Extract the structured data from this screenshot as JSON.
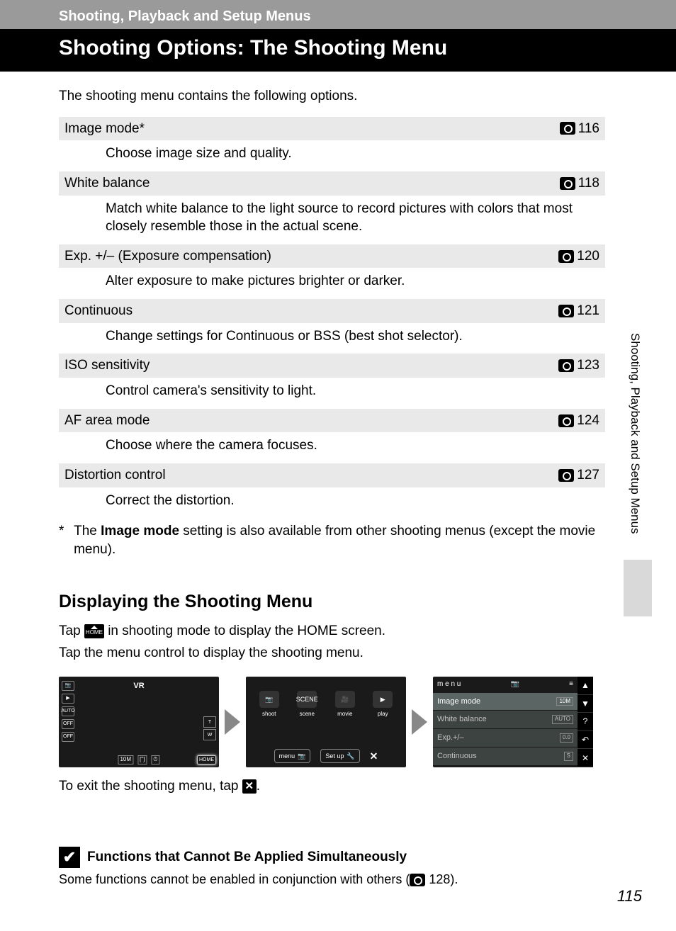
{
  "header": {
    "breadcrumb": "Shooting, Playback and Setup Menus",
    "title": "Shooting Options: The Shooting Menu"
  },
  "intro": "The shooting menu contains the following options.",
  "options": [
    {
      "title": "Image mode*",
      "page": "116",
      "desc": "Choose image size and quality."
    },
    {
      "title": "White balance",
      "page": "118",
      "desc": "Match white balance to the light source to record pictures with colors that most closely resemble those in the actual scene."
    },
    {
      "title": "Exp. +/– (Exposure compensation)",
      "page": "120",
      "desc": "Alter exposure to make pictures brighter or darker."
    },
    {
      "title": "Continuous",
      "page": "121",
      "desc": "Change settings for Continuous or BSS (best shot selector)."
    },
    {
      "title": "ISO sensitivity",
      "page": "123",
      "desc": "Control camera's sensitivity to light."
    },
    {
      "title": "AF area mode",
      "page": "124",
      "desc": "Choose where the camera focuses."
    },
    {
      "title": "Distortion control",
      "page": "127",
      "desc": "Correct the distortion."
    }
  ],
  "footnote": {
    "mark": "*",
    "text_before": "The ",
    "bold": "Image mode",
    "text_after": " setting is also available from other shooting menus (except the movie menu)."
  },
  "section2": {
    "heading": "Displaying the Shooting Menu",
    "line1a": "Tap ",
    "line1b": " in shooting mode to display the HOME screen.",
    "line2": "Tap the menu control to display the shooting menu.",
    "exit_a": "To exit the shooting menu, tap ",
    "exit_b": "."
  },
  "screen1": {
    "vr": "VR",
    "left_icons": [
      "📷",
      "▶",
      "AUTO",
      "OFF",
      "OFF"
    ],
    "right_icons": [
      "T",
      "W"
    ],
    "bottom": [
      "10M",
      "[\"]",
      "⏱"
    ],
    "home": "HOME"
  },
  "screen2": {
    "items": [
      {
        "icon": "📷",
        "label": "shoot"
      },
      {
        "icon": "SCENE",
        "label": "scene"
      },
      {
        "icon": "🎥",
        "label": "movie"
      },
      {
        "icon": "▶",
        "label": "play"
      }
    ],
    "menu_btn": "menu",
    "setup_btn": "Set up",
    "close": "✕"
  },
  "screen3": {
    "title": "m e n u",
    "items": [
      {
        "label": "Image mode",
        "value": "10M"
      },
      {
        "label": "White balance",
        "value": "AUTO"
      },
      {
        "label": "Exp.+/–",
        "value": "0.0"
      },
      {
        "label": "Continuous",
        "value": "S"
      }
    ],
    "side": [
      "▲",
      "▼",
      "?",
      "↶",
      "✕"
    ]
  },
  "note": {
    "heading": "Functions that Cannot Be Applied Simultaneously",
    "body_a": "Some functions cannot be enabled in conjunction with others (",
    "body_page": " 128).",
    "check": "✔"
  },
  "sidebar": "Shooting, Playback and Setup Menus",
  "page_number": "115",
  "home_icon_text": "HOME",
  "x_icon_text": "✕"
}
